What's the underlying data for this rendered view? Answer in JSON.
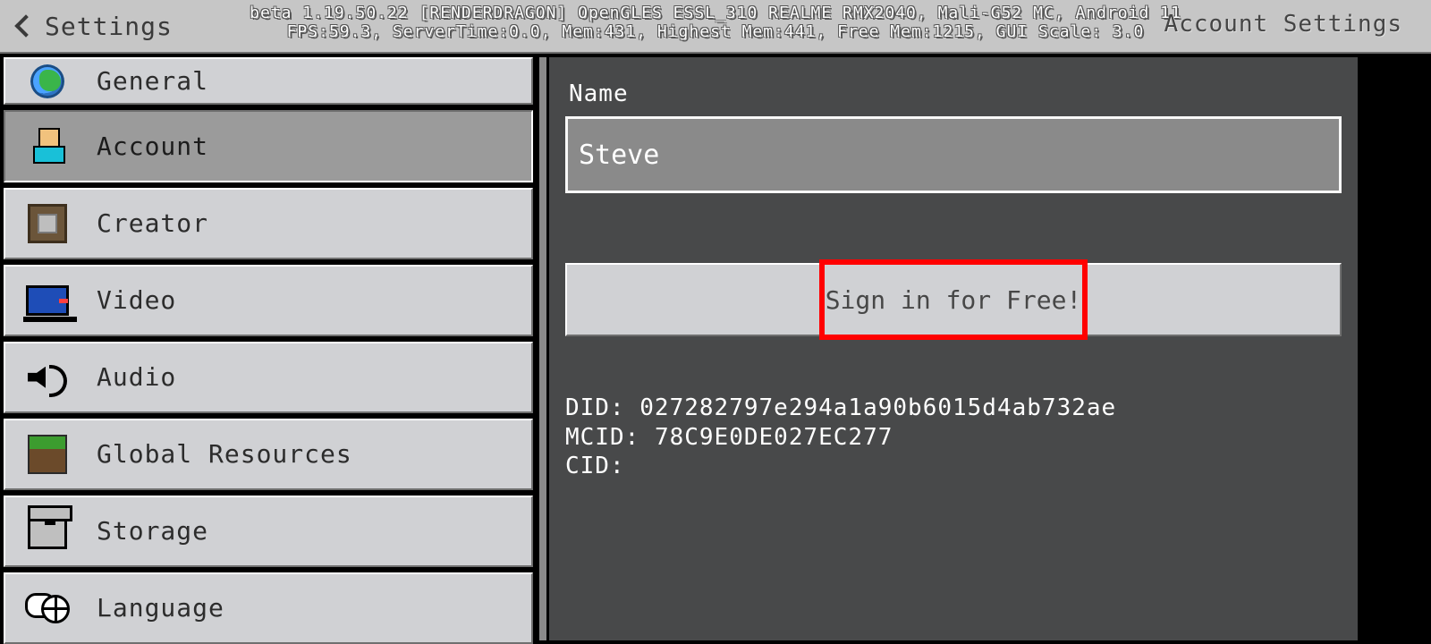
{
  "header": {
    "back_label": "Settings",
    "debug_line1": "beta 1.19.50.22 [RENDERDRAGON] OpenGLES ESSL_310 REALME RMX2040, Mali-G52 MC, Android 11",
    "debug_line2": "FPS:59.3, ServerTime:0.0, Mem:431, Highest Mem:441, Free Mem:1215, GUI Scale: 3.0",
    "right_label": "Account Settings"
  },
  "sidebar": {
    "items": [
      {
        "label": "General"
      },
      {
        "label": "Account"
      },
      {
        "label": "Creator"
      },
      {
        "label": "Video"
      },
      {
        "label": "Audio"
      },
      {
        "label": "Global Resources"
      },
      {
        "label": "Storage"
      },
      {
        "label": "Language"
      }
    ],
    "selected_index": 1
  },
  "content": {
    "name_label": "Name",
    "name_value": "Steve",
    "signin_label": "Sign in for Free!",
    "did_label": "DID:",
    "did_value": "027282797e294a1a90b6015d4ab732ae",
    "mcid_label": "MCID:",
    "mcid_value": "78C9E0DE027EC277",
    "cid_label": "CID:",
    "cid_value": ""
  }
}
